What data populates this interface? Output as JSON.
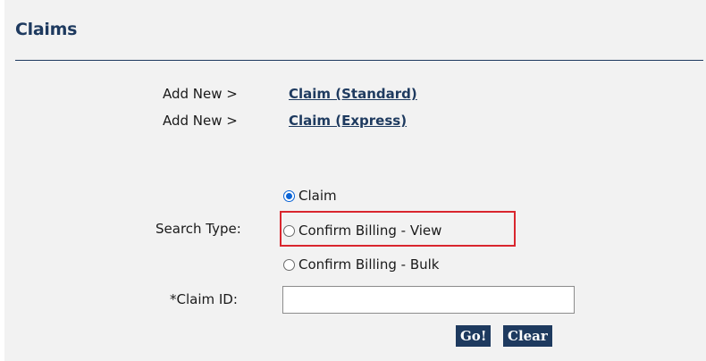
{
  "header": {
    "title": "Claims"
  },
  "add_new": [
    {
      "label": "Add New >",
      "link": "Claim (Standard)"
    },
    {
      "label": "Add New >",
      "link": "Claim (Express)"
    }
  ],
  "search": {
    "label": "Search Type:",
    "options": [
      {
        "label": "Claim",
        "selected": true
      },
      {
        "label": "Confirm Billing - View",
        "selected": false,
        "highlighted": true
      },
      {
        "label": "Confirm Billing - Bulk",
        "selected": false
      }
    ],
    "highlight_color": "#d9262e"
  },
  "claim_id": {
    "label": "*Claim ID:",
    "value": "",
    "placeholder": ""
  },
  "buttons": {
    "go": "Go!",
    "clear": "Clear"
  },
  "colors": {
    "brand": "#1e3a5f",
    "panel_background": "#f2f2f2",
    "radio_selected": "#0a64d6"
  }
}
